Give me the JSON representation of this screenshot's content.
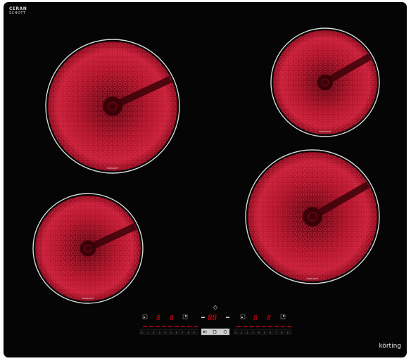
{
  "hob": {
    "top_logo_line1": "CERAN",
    "top_logo_line2": "SCHOTT",
    "brand": "körting",
    "glass_color": "#050505",
    "heat_color": "#c0142a",
    "display_color": "#e30012"
  },
  "burners": [
    {
      "name": "burner-rear-left",
      "label": "HIGHLIGHT"
    },
    {
      "name": "burner-rear-right",
      "label": "HIGHLIGHT"
    },
    {
      "name": "burner-front-left",
      "label": "HIGHLIGHT"
    },
    {
      "name": "burner-front-right",
      "label": "HIGHLIGHT"
    }
  ],
  "controls": {
    "zone_displays": [
      "8",
      "8",
      "8",
      "8"
    ],
    "timer_display": "88",
    "slider_scale": [
      "0",
      "1",
      "2",
      "3",
      "4",
      "5",
      "6",
      "7",
      "8",
      "9"
    ],
    "icons": [
      "power-icon",
      "lock-icon",
      "timer-minus-icon",
      "timer-plus-icon",
      "zone-select-icon",
      "play-icon",
      "pause-icon"
    ]
  }
}
